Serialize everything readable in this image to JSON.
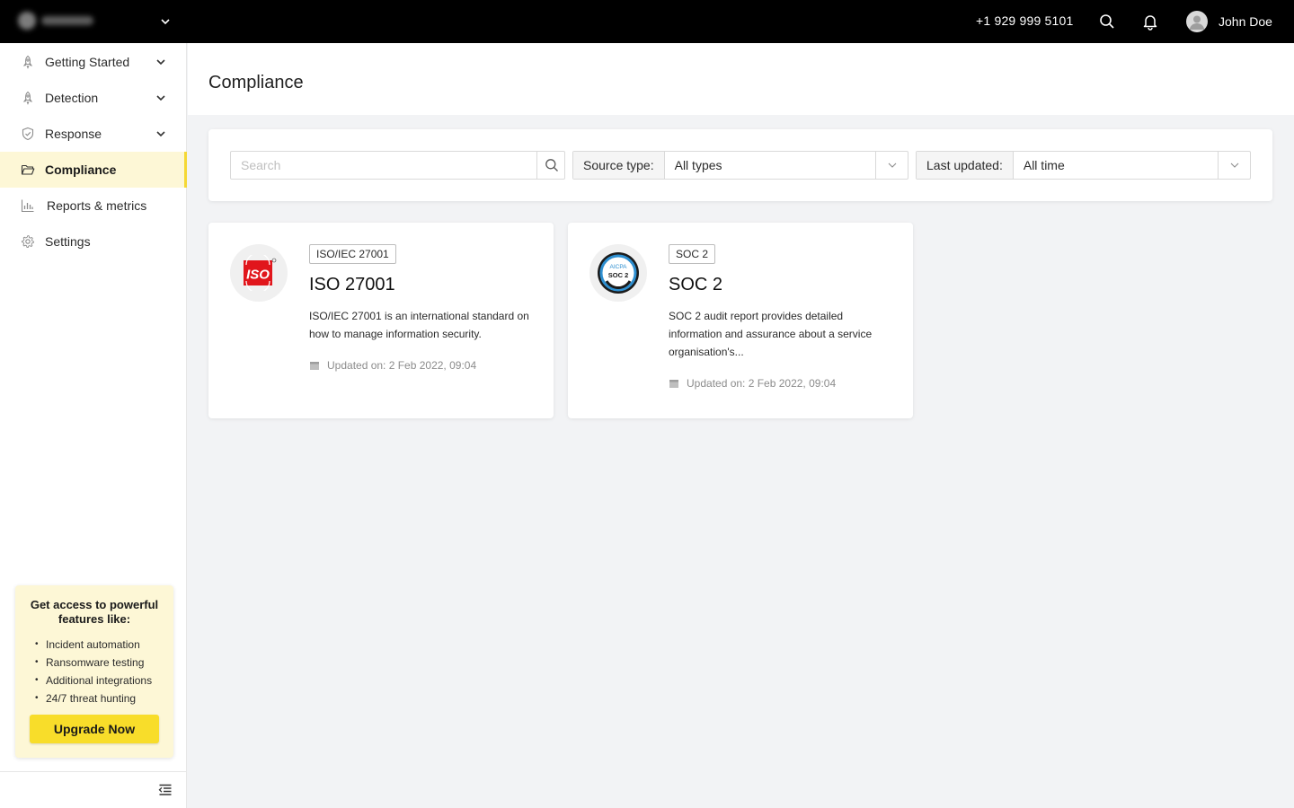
{
  "topbar": {
    "phone": "+1 929 999 5101",
    "user_name": "John Doe",
    "icons": [
      "chevron-down-icon",
      "search-icon",
      "bell-icon",
      "avatar-icon"
    ]
  },
  "sidebar": {
    "items": [
      {
        "label": "Getting Started",
        "icon": "rocket-icon",
        "has_chevron": true,
        "active": false
      },
      {
        "label": "Detection",
        "icon": "rocket-icon",
        "has_chevron": true,
        "active": false
      },
      {
        "label": "Response",
        "icon": "shield-check-icon",
        "has_chevron": true,
        "active": false
      },
      {
        "label": "Compliance",
        "icon": "folder-icon",
        "has_chevron": false,
        "active": true
      },
      {
        "label": "Reports & metrics",
        "icon": "bar-chart-icon",
        "has_chevron": false,
        "active": false
      },
      {
        "label": "Settings",
        "icon": "gear-icon",
        "has_chevron": false,
        "active": false
      }
    ],
    "upgrade": {
      "title": "Get access to powerful features like:",
      "features": [
        "Incident automation",
        "Ransomware testing",
        "Additional integrations",
        "24/7 threat hunting"
      ],
      "button_label": "Upgrade Now"
    }
  },
  "main": {
    "title": "Compliance",
    "filters": {
      "search_placeholder": "Search",
      "source_type_label": "Source type:",
      "source_type_value": "All types",
      "last_updated_label": "Last updated:",
      "last_updated_value": "All time"
    },
    "cards": [
      {
        "tag": "ISO/IEC 27001",
        "title": "ISO 27001",
        "description": "ISO/IEC 27001 is an international standard on how to manage information security.",
        "updated": "Updated on: 2 Feb 2022, 09:04",
        "logo_text": "ISO"
      },
      {
        "tag": "SOC 2",
        "title": "SOC 2",
        "description": "SOC 2 audit report provides detailed information and assurance about a service organisation's...",
        "updated": "Updated on: 2 Feb 2022, 09:04",
        "logo_text_top": "AICPA",
        "logo_text_mid": "SOC 2"
      }
    ]
  },
  "colors": {
    "accent_yellow": "#f8dd2a",
    "active_bg": "#fdf7d6",
    "iso_red": "#e1161c",
    "soc_blue": "#2e8fd0"
  }
}
